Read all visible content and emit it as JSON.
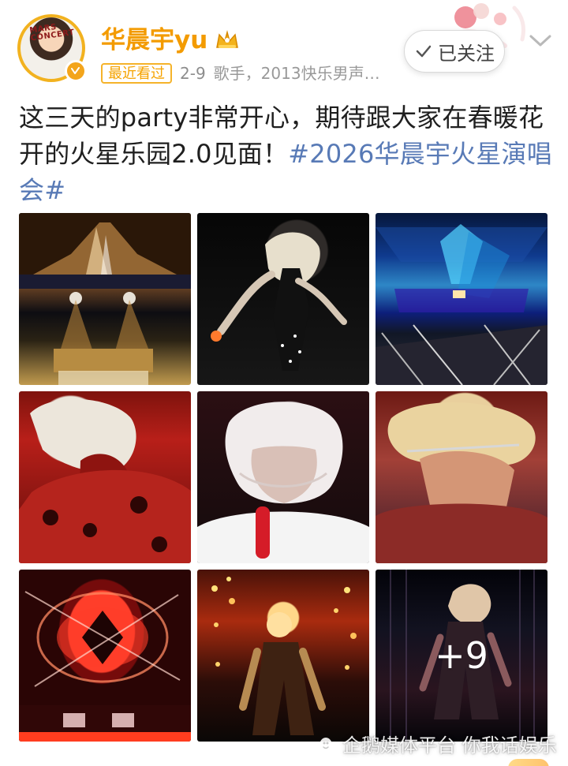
{
  "header": {
    "avatar_text": "MARS CONCERT",
    "user_name": "华晨宇yu",
    "recent_badge": "最近看过",
    "date": "2-9",
    "description": "歌手，2013快乐男声…",
    "follow_label": "已关注",
    "icons": {
      "crown": "crown-icon",
      "verified": "verified-badge-icon",
      "check": "check-icon",
      "dropdown": "chevron-down-icon"
    }
  },
  "post": {
    "line1": "这三天的party非常开心，期待跟大家在春暖花",
    "line2_text": "开的火星乐园2.0见面！",
    "line2_hashtag": "#2026华晨宇火星演唱",
    "line3_hashtag": "会#"
  },
  "photos": {
    "more_count": "+9"
  },
  "watermark": {
    "text": "企鹅媒体平台 你我话娱乐",
    "icon": "penguin-icon"
  },
  "colors": {
    "name": "#f39b00",
    "badge": "#f5b32a",
    "hashtag": "#587ab6",
    "text": "#1f1f1f",
    "meta": "#999999"
  }
}
